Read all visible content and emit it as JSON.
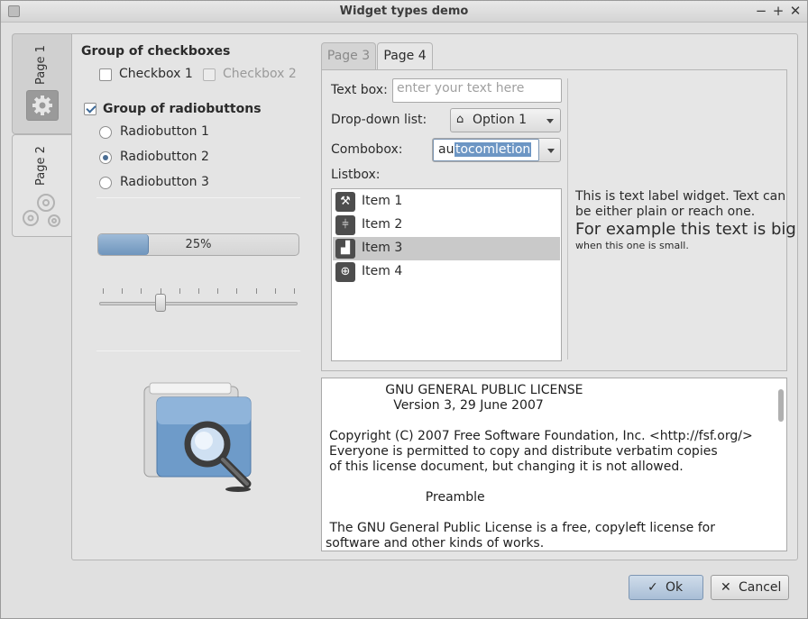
{
  "window": {
    "title": "Widget types demo"
  },
  "vtabs": [
    {
      "label": "Page 1"
    },
    {
      "label": "Page 2"
    }
  ],
  "checkgroup": {
    "title": "Group of checkboxes",
    "items": [
      {
        "label": "Checkbox 1",
        "checked": false,
        "enabled": true
      },
      {
        "label": "Checkbox 2",
        "checked": false,
        "enabled": false
      }
    ]
  },
  "radiogroup": {
    "title": "Group of radiobuttons",
    "checked": true,
    "items": [
      {
        "label": "Radiobutton 1",
        "selected": false
      },
      {
        "label": "Radiobutton 2",
        "selected": true
      },
      {
        "label": "Radiobutton 3",
        "selected": false
      }
    ]
  },
  "progress": {
    "value": 0.25,
    "text": "25%"
  },
  "slider": {
    "value": 0.3
  },
  "tabs": [
    {
      "label": "Page 3",
      "active": false
    },
    {
      "label": "Page 4",
      "active": true
    }
  ],
  "form": {
    "textbox_label": "Text box:",
    "textbox_placeholder": "enter your text here",
    "dropdown_label": "Drop-down list:",
    "dropdown_value": "Option 1",
    "combobox_label": "Combobox:",
    "combobox_typed": "au",
    "combobox_completion": "tocomletion",
    "listbox_label": "Listbox:"
  },
  "listbox": {
    "items": [
      {
        "label": "Item 1",
        "icon": "worker-icon",
        "selected": false
      },
      {
        "label": "Item 2",
        "icon": "sliders-icon",
        "selected": false
      },
      {
        "label": "Item 3",
        "icon": "chart-icon",
        "selected": true
      },
      {
        "label": "Item 4",
        "icon": "globe-icon",
        "selected": false
      }
    ]
  },
  "label_widget": {
    "line1": "This is text label widget. Text can",
    "line2": "be either plain or reach one.",
    "big": "For example this text is big",
    "small": "when this one is small."
  },
  "license_text": [
    "              GNU GENERAL PUBLIC LICENSE",
    "                Version 3, 29 June 2007",
    "",
    "Copyright (C) 2007 Free Software Foundation, Inc. <http://fsf.org/>",
    "Everyone is permitted to copy and distribute verbatim copies",
    "of this license document, but changing it is not allowed.",
    "",
    "                        Preamble",
    "",
    " The GNU General Public License is a free, copyleft license for",
    "software and other kinds of works."
  ],
  "buttons": {
    "ok": "Ok",
    "cancel": "Cancel"
  }
}
